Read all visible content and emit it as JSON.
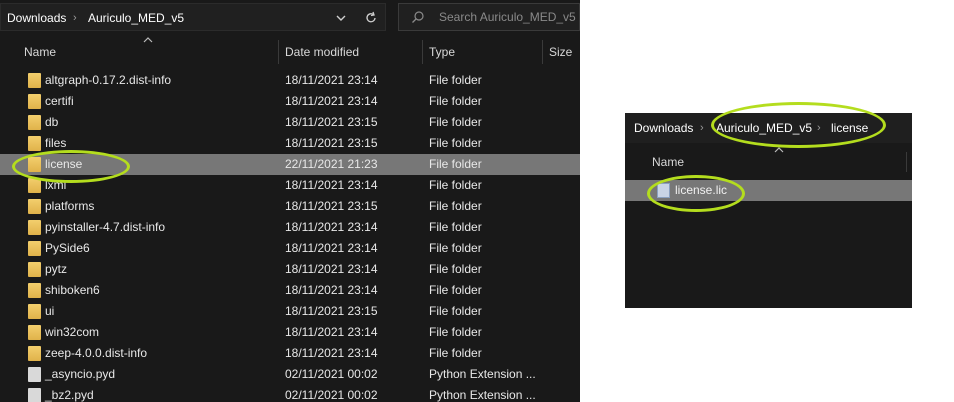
{
  "left_window": {
    "breadcrumb": [
      "Downloads",
      "Auriculo_MED_v5"
    ],
    "search_placeholder": "Search Auriculo_MED_v5",
    "columns": [
      "Name",
      "Date modified",
      "Type",
      "Size"
    ],
    "rows": [
      {
        "name": "altgraph-0.17.2.dist-info",
        "date": "18/11/2021 23:14",
        "type": "File folder",
        "icon": "folder-icon"
      },
      {
        "name": "certifi",
        "date": "18/11/2021 23:14",
        "type": "File folder",
        "icon": "folder-icon"
      },
      {
        "name": "db",
        "date": "18/11/2021 23:15",
        "type": "File folder",
        "icon": "folder-icon"
      },
      {
        "name": "files",
        "date": "18/11/2021 23:15",
        "type": "File folder",
        "icon": "folder-icon"
      },
      {
        "name": "license",
        "date": "22/11/2021 21:23",
        "type": "File folder",
        "icon": "folder-icon",
        "selected": true
      },
      {
        "name": "lxml",
        "date": "18/11/2021 23:14",
        "type": "File folder",
        "icon": "folder-icon"
      },
      {
        "name": "platforms",
        "date": "18/11/2021 23:15",
        "type": "File folder",
        "icon": "folder-icon"
      },
      {
        "name": "pyinstaller-4.7.dist-info",
        "date": "18/11/2021 23:14",
        "type": "File folder",
        "icon": "folder-icon"
      },
      {
        "name": "PySide6",
        "date": "18/11/2021 23:14",
        "type": "File folder",
        "icon": "folder-icon"
      },
      {
        "name": "pytz",
        "date": "18/11/2021 23:14",
        "type": "File folder",
        "icon": "folder-icon"
      },
      {
        "name": "shiboken6",
        "date": "18/11/2021 23:14",
        "type": "File folder",
        "icon": "folder-icon"
      },
      {
        "name": "ui",
        "date": "18/11/2021 23:15",
        "type": "File folder",
        "icon": "folder-icon"
      },
      {
        "name": "win32com",
        "date": "18/11/2021 23:14",
        "type": "File folder",
        "icon": "folder-icon"
      },
      {
        "name": "zeep-4.0.0.dist-info",
        "date": "18/11/2021 23:14",
        "type": "File folder",
        "icon": "folder-icon"
      },
      {
        "name": "_asyncio.pyd",
        "date": "02/11/2021 00:02",
        "type": "Python Extension ...",
        "icon": "python-file-icon"
      },
      {
        "name": "_bz2.pyd",
        "date": "02/11/2021 00:02",
        "type": "Python Extension ...",
        "icon": "python-file-icon"
      }
    ]
  },
  "right_window": {
    "breadcrumb": [
      "Downloads",
      "Auriculo_MED_v5",
      "license"
    ],
    "column_name": "Name",
    "file": {
      "name": "license.lic",
      "icon": "lic-file-icon"
    }
  },
  "highlight_color": "#b4dd1e",
  "selection_color": "#777777"
}
